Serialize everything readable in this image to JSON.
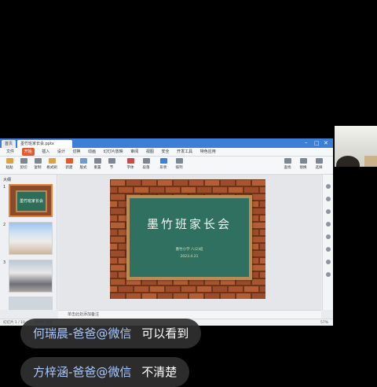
{
  "screen_share": {
    "tabs": [
      "首页",
      "墨竹班家长会.pptx"
    ],
    "menu": [
      "文件",
      "开始",
      "插入",
      "设计",
      "切换",
      "动画",
      "幻灯片放映",
      "审阅",
      "视图",
      "安全",
      "开发工具",
      "特色应用"
    ],
    "menu_active": "开始",
    "ribbon": [
      "粘贴",
      "剪切",
      "复制",
      "格式刷",
      "新建",
      "版式",
      "重置",
      "节",
      "字体",
      "段落",
      "形状",
      "排列",
      "查找",
      "替换",
      "选择"
    ],
    "thumb_label": "大纲",
    "thumb1_title": "墨竹班家长会",
    "slide": {
      "title": "墨竹班家长会",
      "subtitle": "墨竹小学 八(2)班",
      "date": "2023.4.21"
    },
    "notes_placeholder": "单击此处添加备注",
    "status": {
      "slide_info": "幻灯片 1 / 10",
      "theme": "Office 主题",
      "zoom": "57%"
    },
    "colors": {
      "accent": "#3d7fd6",
      "wps_orange": "#e55a2b",
      "board": "#2f7060"
    }
  },
  "chat": [
    {
      "name": "何瑞晨-爸爸@微信",
      "message": "可以看到"
    },
    {
      "name": "方梓涵-爸爸@微信",
      "message": "不清楚"
    }
  ]
}
